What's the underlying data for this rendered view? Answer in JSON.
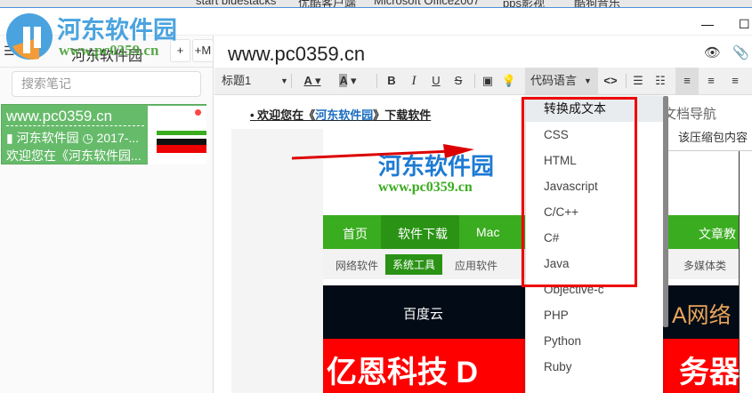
{
  "taskbar": {
    "items": [
      "start bluestacks",
      "优酷客户端",
      "Microsoft Office2007",
      "pps影视",
      "酷狗音乐"
    ]
  },
  "watermark": {
    "brand": "河东软件园",
    "url": "www.pc0359.cn"
  },
  "window": {
    "minimize": "—",
    "maximize": "☐"
  },
  "sidebar": {
    "title": "河东软件园",
    "add_label": "+",
    "add_md_label": "+M",
    "search_placeholder": "搜索笔记",
    "note": {
      "title": "www.pc0359.cn",
      "notebook": "河东软件园",
      "date": "2017-...",
      "snippet": "欢迎您在《河东软件园..."
    }
  },
  "editor": {
    "title": "www.pc0359.cn",
    "toolbar": {
      "heading": "标题1",
      "code_lang": "代码语言",
      "code": "<>"
    },
    "bullet": {
      "prefix": "欢迎您在《",
      "link": "河东软件园",
      "suffix": "》下载软件"
    }
  },
  "site": {
    "brand": "河东软件园",
    "url": "www.pc0359.cn",
    "nav": [
      "首页",
      "软件下载",
      "Mac",
      "文章教"
    ],
    "subnav": [
      "网络软件",
      "系统工具",
      "应用软件",
      "多媒体类"
    ],
    "banner1": "百度云",
    "banner1_right": "A网络",
    "banner2_left": "亿恩科技 D",
    "banner2_right": "务器"
  },
  "dropdown": {
    "items": [
      "转换成文本",
      "CSS",
      "HTML",
      "Javascript",
      "C/C++",
      "C#",
      "Java",
      "Objective-c",
      "PHP",
      "Python",
      "Ruby"
    ]
  },
  "doc_nav": {
    "title": "文档导航",
    "content": "该压缩包内容"
  },
  "colors": {
    "green": "#66bb6a",
    "red": "#e00000",
    "site_green": "#3aac1f"
  }
}
